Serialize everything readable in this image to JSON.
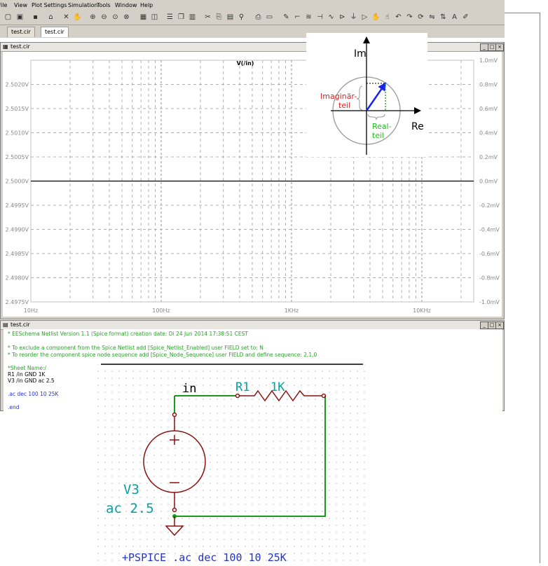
{
  "menu": [
    "File",
    "View",
    "Plot Settings",
    "Simulation",
    "Tools",
    "Window",
    "Help"
  ],
  "tabs": [
    "test.cir",
    "test.cir"
  ],
  "plot_window": {
    "title": "test.cir"
  },
  "netlist_window": {
    "title": "test.cir"
  },
  "chart_data": {
    "type": "line",
    "title": "V(/in)",
    "x_scale": "log",
    "xlim": [
      10,
      25000
    ],
    "x_ticks": [
      "10Hz",
      "100Hz",
      "1KHz",
      "10KHz"
    ],
    "left_ticks": [
      "2.5020V",
      "2.5015V",
      "2.5010V",
      "2.5005V",
      "2.5000V",
      "2.4995V",
      "2.4990V",
      "2.4985V",
      "2.4980V",
      "2.4975V"
    ],
    "right_ticks": [
      "1.0mV",
      "0.8mV",
      "0.6mV",
      "0.4mV",
      "0.2mV",
      "0.0mV",
      "-0.2mV",
      "-0.4mV",
      "-0.6mV",
      "-0.8mV",
      "-1.0mV"
    ],
    "ylim_left": [
      2.4975,
      2.5025
    ],
    "ylim_right": [
      -1.0,
      1.0
    ],
    "series": [
      {
        "name": "V(/in)",
        "x": [
          10,
          25000
        ],
        "y": [
          2.5,
          2.5
        ],
        "color": "#000000"
      }
    ],
    "grid": true
  },
  "netlist": {
    "header": "* EESchema Netlist Version 1.1 (Spice format) creation date: Di 24 Jun 2014 17:38:51 CEST",
    "exclude": "* To exclude a component from the Spice Netlist add [Spice_Netlist_Enabled] user FIELD set to: N",
    "reorder": "* To reorder the component spice node sequence add [Spice_Node_Sequence] user FIELD and define sequence: 2,1,0",
    "sheet": "*Sheet Name:/",
    "r1": "R1  /in GND 1K",
    "v3": "V3  /in GND ac 2.5",
    "ac": ".ac dec 100 10 25K",
    "end": ".end"
  },
  "schematic": {
    "net_label": "in",
    "r_ref": "R1",
    "r_value": "1K",
    "v_ref": "V3",
    "v_value": "ac 2.5",
    "plus": "+",
    "minus": "−",
    "pspice": "+PSPICE .ac dec 100 10 25K",
    "colors": {
      "wire": "#1a9a1a",
      "component": "#8b1010",
      "label": "#0aa0a0",
      "pspice": "#2233cc"
    }
  },
  "phasor": {
    "im": "Im",
    "re": "Re",
    "imag_part": "Imaginär-\nteil",
    "real_part": "Real-\nteil",
    "colors": {
      "imag": "#dd2222",
      "real": "#22bb22",
      "vector": "#1a22ee"
    }
  }
}
